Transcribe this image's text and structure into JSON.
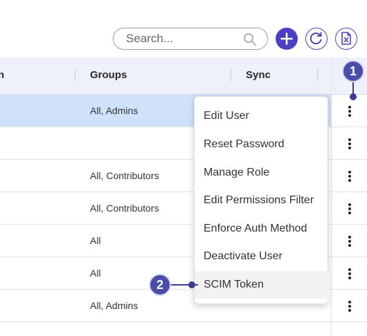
{
  "toolbar": {
    "search_placeholder": "Search...",
    "search_icon": "search-icon",
    "add_icon": "plus-icon",
    "refresh_icon": "refresh-icon",
    "export_icon": "file-export-icon",
    "accent_color": "#4b3fc2"
  },
  "table": {
    "columns": [
      "n",
      "Groups",
      "Sync"
    ],
    "rows": [
      {
        "groups": "All, Admins",
        "selected": true
      },
      {
        "groups": ""
      },
      {
        "groups": "All, Contributors"
      },
      {
        "groups": "All, Contributors"
      },
      {
        "groups": "All"
      },
      {
        "groups": "All"
      },
      {
        "groups": "All, Admins"
      }
    ],
    "row_action_icon": "vertical-ellipsis-icon"
  },
  "context_menu": {
    "items": [
      "Edit User",
      "Reset Password",
      "Manage Role",
      "Edit Permissions Filter",
      "Enforce Auth Method",
      "Deactivate User",
      "SCIM Token"
    ],
    "highlighted": "SCIM Token"
  },
  "callouts": {
    "one": "1",
    "two": "2",
    "color": "#4c4caa"
  }
}
